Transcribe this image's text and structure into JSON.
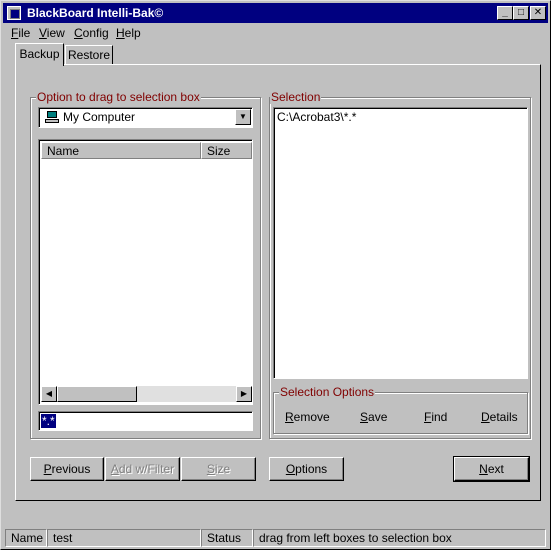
{
  "window": {
    "title": "BlackBoard Intelli-Bak©",
    "controls": {
      "minimize": "_",
      "maximize": "□",
      "close": "✕"
    }
  },
  "menu": [
    {
      "label": "File",
      "underline_index": 0
    },
    {
      "label": "View",
      "underline_index": 0
    },
    {
      "label": "Config",
      "underline_index": 0
    },
    {
      "label": "Help",
      "underline_index": 0
    }
  ],
  "tabs": {
    "backup": "Backup",
    "restore": "Restore",
    "active": "backup"
  },
  "source": {
    "group_label": "Option to drag to selection box",
    "drive": {
      "value": "My Computer",
      "icon": "computer-icon"
    },
    "columns": {
      "name": "Name",
      "size": "Size"
    },
    "rows": [],
    "filter_value": "*.*"
  },
  "selection": {
    "group_label": "Selection",
    "items": [
      "C:\\Acrobat3\\*.*"
    ]
  },
  "selection_options": {
    "group_label": "Selection Options",
    "remove": "Remove",
    "save": "Save",
    "find": "Find",
    "details": "Details"
  },
  "buttons": {
    "previous": "Previous",
    "add_filter": "Add w/Filter",
    "size": "Size",
    "options": "Options",
    "next": "Next"
  },
  "status": {
    "name_label": "Name",
    "name_value": "test",
    "status_label": "Status",
    "status_value": "drag from left boxes to selection box"
  },
  "colors": {
    "titlebar": "#000080",
    "window": "#c0c0c0",
    "group_label": "#800000",
    "selection_highlight": "#000080"
  }
}
